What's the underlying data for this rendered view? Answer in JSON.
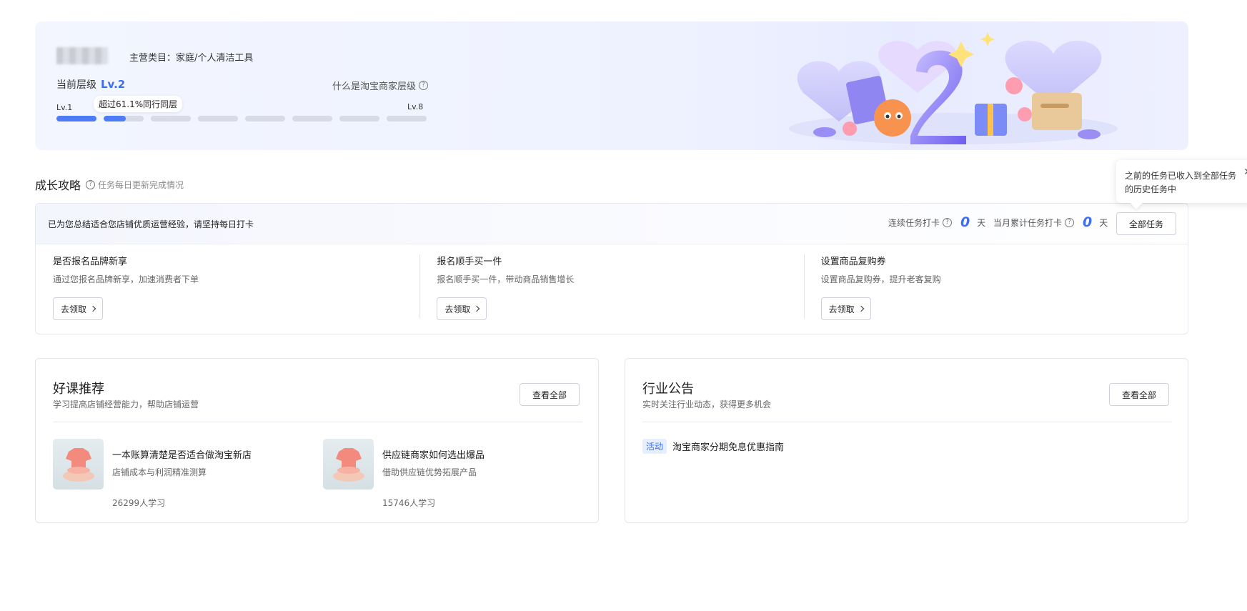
{
  "banner": {
    "category": "主营类目：家庭/个人清洁工具",
    "current_level_label": "当前层级",
    "current_level_value": "Lv.2",
    "what_is_level": "什么是淘宝商家层级",
    "level_min": "Lv.1",
    "level_max": "Lv.8",
    "percentile_badge": "超过61.1%同行同层",
    "level_progress": {
      "completed_segments": 1,
      "current_segment_fill": 0.55,
      "total_segments": 8
    }
  },
  "growth": {
    "title": "成长攻略",
    "subtitle": "任务每日更新完成情况",
    "popover_text": "之前的任务已收入到全部任务的历史任务中",
    "banner_text": "已为您总结适合您店铺优质运营经验，请坚持每日打卡",
    "streak_label": "连续任务打卡",
    "streak_value": "0",
    "streak_unit": "天",
    "monthly_label": "当月累计任务打卡",
    "monthly_value": "0",
    "monthly_unit": "天",
    "all_tasks_button": "全部任务",
    "tasks": [
      {
        "title": "是否报名品牌新享",
        "desc": "通过您报名品牌新享，加速消费者下单",
        "button": "去领取"
      },
      {
        "title": "报名顺手买一件",
        "desc": "报名顺手买一件，带动商品销售增长",
        "button": "去领取"
      },
      {
        "title": "设置商品复购券",
        "desc": "设置商品复购券，提升老客复购",
        "button": "去领取"
      }
    ]
  },
  "courses": {
    "title": "好课推荐",
    "subtitle": "学习提高店铺经营能力，帮助店铺运营",
    "view_all": "查看全部",
    "items": [
      {
        "title": "一本账算清楚是否适合做淘宝新店",
        "desc": "店铺成本与利润精准测算",
        "count": "26299人学习"
      },
      {
        "title": "供应链商家如何选出爆品",
        "desc": "借助供应链优势拓展产品",
        "count": "15746人学习"
      }
    ]
  },
  "notices": {
    "title": "行业公告",
    "subtitle": "实时关注行业动态，获得更多机会",
    "view_all": "查看全部",
    "items": [
      {
        "tag": "活动",
        "text": "淘宝商家分期免息优惠指南"
      }
    ]
  },
  "colors": {
    "accent": "#3d6ef5",
    "progress": "#4e7bf6",
    "track": "#d8dbe6"
  }
}
